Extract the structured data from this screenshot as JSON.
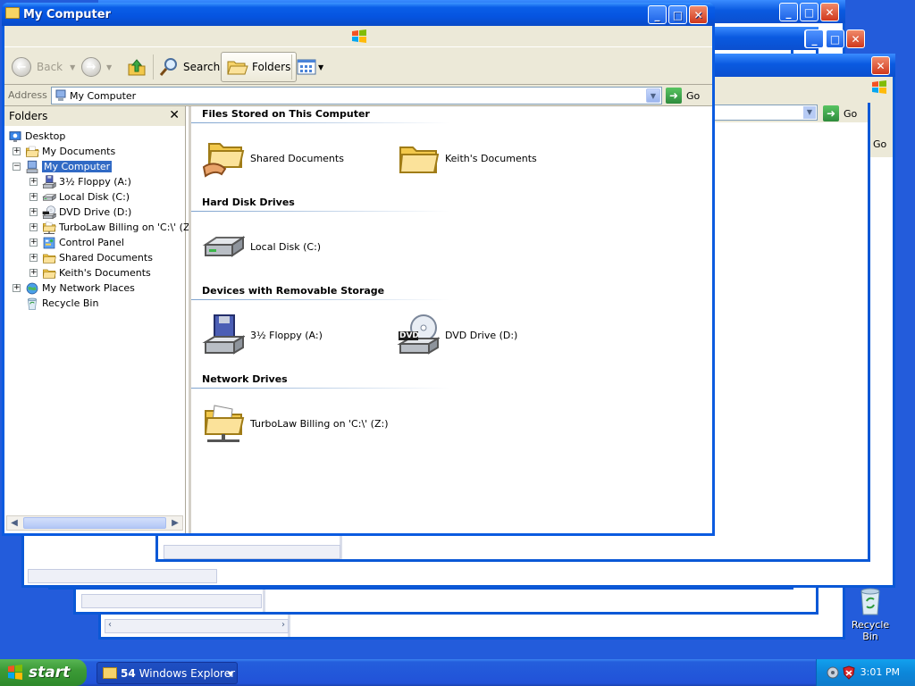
{
  "window": {
    "title": "My Computer",
    "minimize_glyph": "_",
    "maximize_glyph": "□",
    "close_glyph": "✕"
  },
  "toolbar": {
    "back_label": "Back",
    "search_label": "Search",
    "folders_label": "Folders"
  },
  "address": {
    "label": "Address",
    "value": "My Computer",
    "go_label": "Go"
  },
  "folders_pane": {
    "title": "Folders",
    "close_glyph": "✕",
    "tree": [
      {
        "label": "Desktop",
        "icon": "desktop-icon",
        "expander": ""
      },
      {
        "label": "My Documents",
        "icon": "my-documents-icon",
        "expander": "+"
      },
      {
        "label": "My Computer",
        "icon": "my-computer-icon",
        "expander": "−",
        "selected": true
      },
      {
        "label": "3½ Floppy (A:)",
        "icon": "floppy-icon",
        "expander": "+"
      },
      {
        "label": "Local Disk (C:)",
        "icon": "hard-disk-icon",
        "expander": "+"
      },
      {
        "label": "DVD Drive (D:)",
        "icon": "dvd-drive-icon",
        "expander": "+"
      },
      {
        "label": "TurboLaw Billing on 'C:\\' (Z:)",
        "icon": "network-drive-icon",
        "expander": "+"
      },
      {
        "label": "Control Panel",
        "icon": "control-panel-icon",
        "expander": "+"
      },
      {
        "label": "Shared Documents",
        "icon": "folder-icon",
        "expander": "+"
      },
      {
        "label": "Keith's Documents",
        "icon": "folder-icon",
        "expander": "+"
      },
      {
        "label": "My Network Places",
        "icon": "network-places-icon",
        "expander": "+"
      },
      {
        "label": "Recycle Bin",
        "icon": "recycle-bin-icon",
        "expander": ""
      }
    ]
  },
  "content": {
    "groups": [
      {
        "title": "Files Stored on This Computer",
        "items": [
          {
            "label": "Shared Documents",
            "icon": "shared-folder-icon"
          },
          {
            "label": "Keith's Documents",
            "icon": "folder-icon"
          }
        ]
      },
      {
        "title": "Hard Disk Drives",
        "items": [
          {
            "label": "Local Disk (C:)",
            "icon": "hard-disk-icon"
          }
        ]
      },
      {
        "title": "Devices with Removable Storage",
        "items": [
          {
            "label": "3½ Floppy (A:)",
            "icon": "floppy-icon"
          },
          {
            "label": "DVD Drive (D:)",
            "icon": "dvd-drive-icon"
          }
        ]
      },
      {
        "title": "Network Drives",
        "items": [
          {
            "label": "TurboLaw Billing on 'C:\\' (Z:)",
            "icon": "network-drive-icon"
          }
        ]
      }
    ],
    "dvd_badge": "DVD"
  },
  "background_windows": {
    "go_label": "Go",
    "go_label_2": "Go"
  },
  "desktop": {
    "recycle_bin_label": "Recycle Bin"
  },
  "taskbar": {
    "start_label": "start",
    "task_count": "54",
    "task_label": "Windows Explorer",
    "clock": "3:01 PM"
  },
  "colors": {
    "desktop": "#235CDB",
    "titlebar": "#0554E0",
    "selection": "#316AC5",
    "start_green": "#3C9B37"
  }
}
